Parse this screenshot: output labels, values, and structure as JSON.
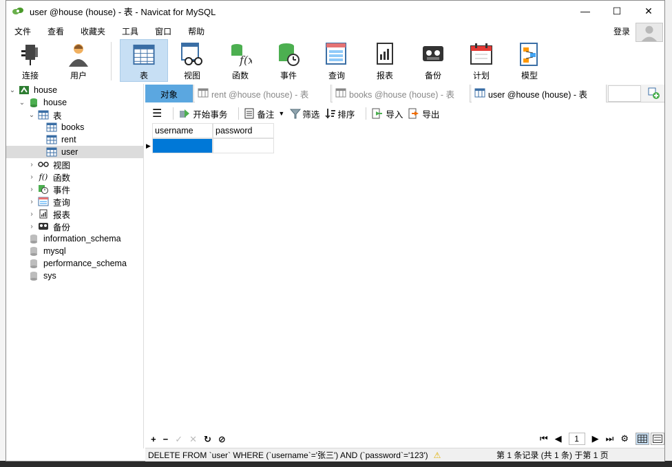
{
  "window": {
    "title": "user @house (house) - 表 - Navicat for MySQL",
    "controls": {
      "minimize": "—",
      "maximize": "☐",
      "close": "✕"
    }
  },
  "menu": [
    "文件",
    "查看",
    "收藏夹",
    "工具",
    "窗口",
    "帮助"
  ],
  "login_label": "登录",
  "toolbar": [
    {
      "label": "连接",
      "icon": "plug-icon",
      "active": false
    },
    {
      "label": "用户",
      "icon": "user-icon",
      "active": false
    },
    {
      "label": "表",
      "icon": "table-icon",
      "active": true
    },
    {
      "label": "视图",
      "icon": "view-icon",
      "active": false
    },
    {
      "label": "函数",
      "icon": "function-icon",
      "active": false
    },
    {
      "label": "事件",
      "icon": "event-icon",
      "active": false
    },
    {
      "label": "查询",
      "icon": "query-icon",
      "active": false
    },
    {
      "label": "报表",
      "icon": "report-icon",
      "active": false
    },
    {
      "label": "备份",
      "icon": "backup-icon",
      "active": false
    },
    {
      "label": "计划",
      "icon": "schedule-icon",
      "active": false
    },
    {
      "label": "模型",
      "icon": "model-icon",
      "active": false
    }
  ],
  "tree": {
    "connection": "house",
    "database": "house",
    "tables_label": "表",
    "tables": [
      "books",
      "rent",
      "user"
    ],
    "selected_table": "user",
    "groups": [
      "视图",
      "函数",
      "事件",
      "查询",
      "报表",
      "备份"
    ],
    "other_databases": [
      "information_schema",
      "mysql",
      "performance_schema",
      "sys"
    ]
  },
  "tabs": {
    "objects": "对象",
    "items": [
      {
        "label": "rent @house (house) - 表",
        "state": "inactive"
      },
      {
        "label": "books @house (house) - 表",
        "state": "inactive"
      },
      {
        "label": "user @house (house) - 表",
        "state": "current"
      }
    ]
  },
  "subtoolbar": {
    "begin_transaction": "开始事务",
    "memo": "备注",
    "filter": "筛选",
    "sort": "排序",
    "import": "导入",
    "export": "导出"
  },
  "grid": {
    "columns": [
      "username",
      "password"
    ],
    "rows": [
      [
        "",
        ""
      ]
    ]
  },
  "pager": {
    "page": "1"
  },
  "status": {
    "sql": "DELETE FROM `user` WHERE (`username`='张三') AND (`password`='123')",
    "record_info": "第 1 条记录 (共 1 条) 于第 1 页"
  },
  "colors": {
    "active_tab": "#5ba7e0",
    "selected_cell": "#0078d7",
    "toolbar_active": "#c7dff4"
  }
}
